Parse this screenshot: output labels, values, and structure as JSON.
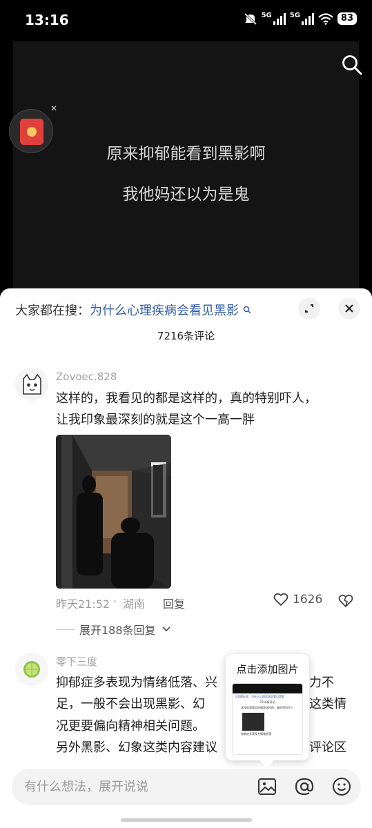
{
  "status": {
    "time": "13:16",
    "net1": "5G",
    "net2": "5G",
    "battery": "83"
  },
  "video": {
    "caption1": "原来抑郁能看到黑影啊",
    "caption2": "我他妈还以为是鬼"
  },
  "header": {
    "search_prefix": "大家都在搜：",
    "search_term": "为什么心理疾病会看见黑影",
    "comment_count": "7216条评论"
  },
  "comments": [
    {
      "username": "Zovoec.828",
      "lines": [
        "这样的，我看见的都是这样的，真的特别吓人，",
        "让我印象最深刻的就是这个一高一胖"
      ],
      "time": "昨天21:52",
      "location": "湖南",
      "reply": "回复",
      "likes": "1626",
      "expand": "展开188条回复"
    },
    {
      "username": "零下三度",
      "lines": [
        "抑郁症多表现为情绪低落、兴",
        "力不",
        "足，一般不会出现黑影、幻",
        "这类情",
        "况更要偏向精神相关问题。",
        "另外黑影、幻象这类内容建议",
        "评论区"
      ]
    }
  ],
  "popup": {
    "title": "点击添加图片",
    "thumb_text": [
      "大家都在搜：为什么心理疾病会看见黑影",
      "7216条评论",
      "这样的我看见的都是这样的，真的特别吓人",
      "抑郁症多表现为情绪低落"
    ]
  },
  "input": {
    "placeholder": "有什么想法，展开说说"
  }
}
